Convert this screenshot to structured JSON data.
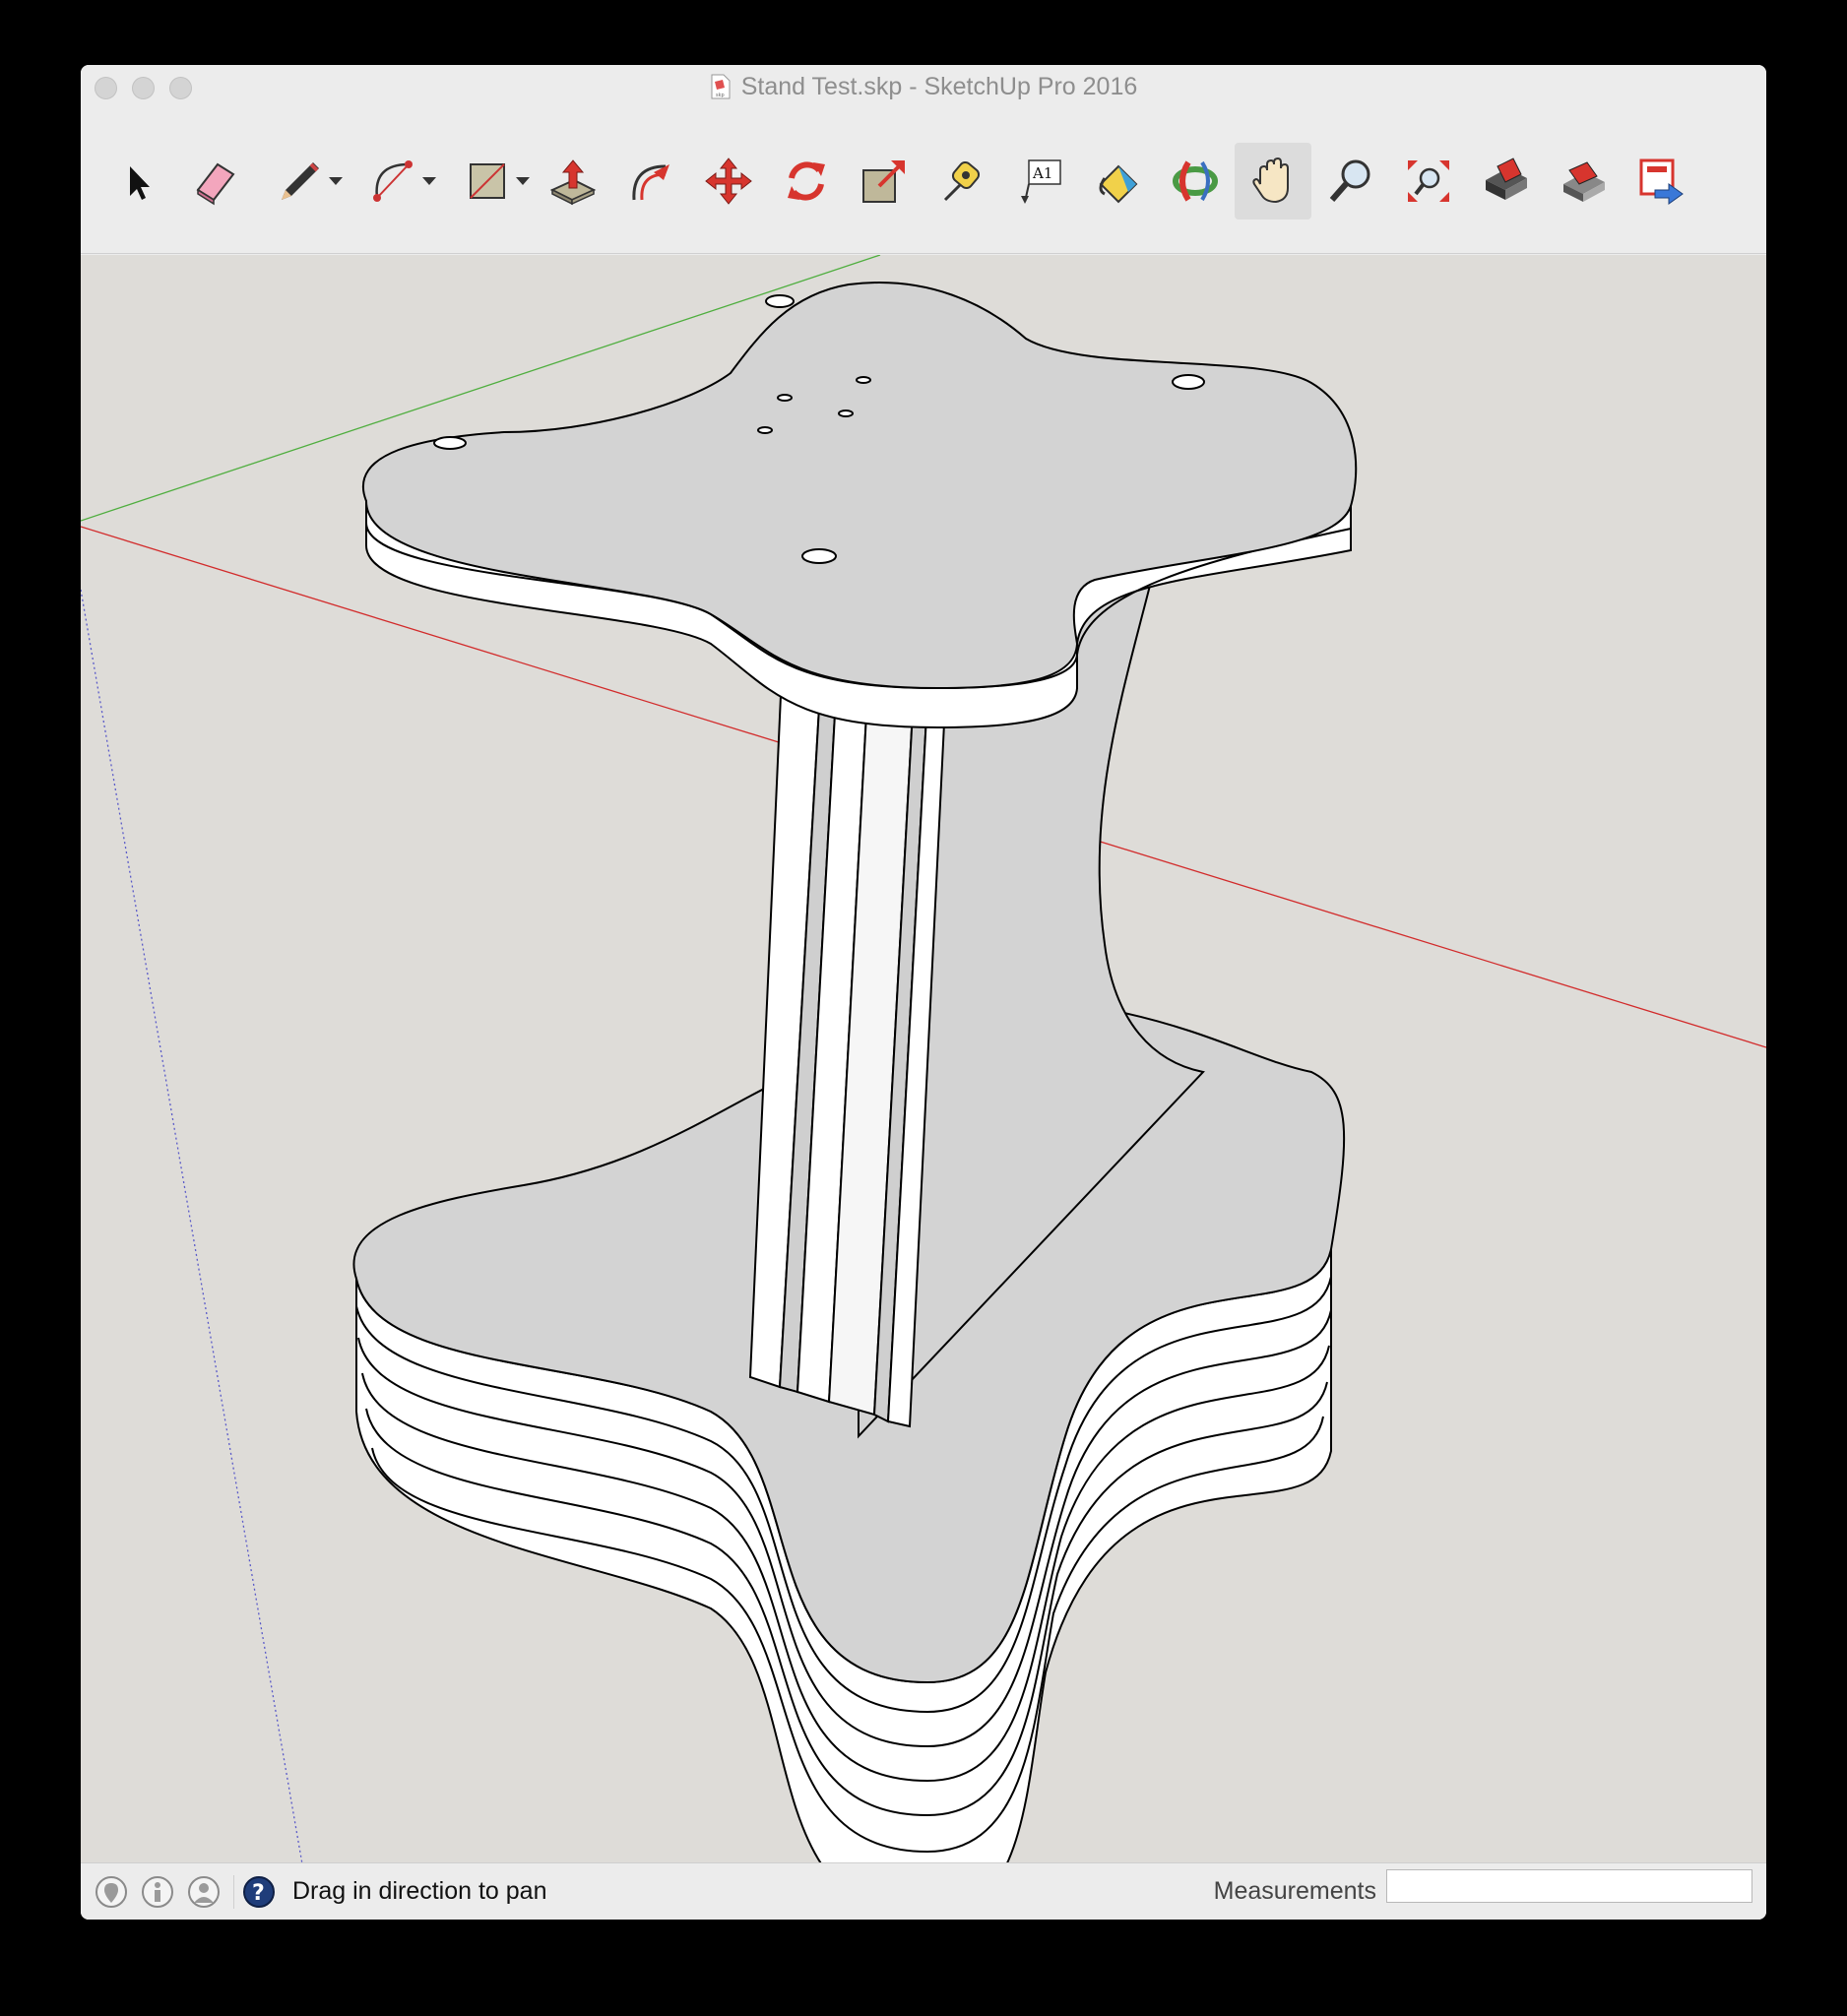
{
  "window": {
    "title": "Stand Test.skp - SketchUp Pro 2016"
  },
  "toolbar": {
    "tools": [
      {
        "name": "select",
        "icon": "arrow-cursor-icon"
      },
      {
        "name": "eraser",
        "icon": "eraser-icon"
      },
      {
        "name": "line",
        "icon": "pencil-icon",
        "has_dropdown": true
      },
      {
        "name": "arc",
        "icon": "arc-icon",
        "has_dropdown": true
      },
      {
        "name": "rectangle",
        "icon": "rectangle-icon",
        "has_dropdown": true
      },
      {
        "name": "push-pull",
        "icon": "push-pull-icon"
      },
      {
        "name": "offset",
        "icon": "offset-icon"
      },
      {
        "name": "move",
        "icon": "move-icon"
      },
      {
        "name": "rotate",
        "icon": "rotate-icon"
      },
      {
        "name": "scale",
        "icon": "scale-icon"
      },
      {
        "name": "tape-measure",
        "icon": "tape-measure-icon"
      },
      {
        "name": "text",
        "icon": "text-icon",
        "label": "A1"
      },
      {
        "name": "paint-bucket",
        "icon": "paint-bucket-icon"
      },
      {
        "name": "orbit",
        "icon": "orbit-icon"
      },
      {
        "name": "pan",
        "icon": "hand-icon",
        "active": true
      },
      {
        "name": "zoom",
        "icon": "magnifier-icon"
      },
      {
        "name": "zoom-extents",
        "icon": "zoom-extents-icon"
      },
      {
        "name": "warehouse",
        "icon": "warehouse-icon"
      },
      {
        "name": "extension-warehouse",
        "icon": "extension-warehouse-icon"
      },
      {
        "name": "send-to-layout",
        "icon": "layout-icon"
      }
    ]
  },
  "statusbar": {
    "icons": [
      "geo-location-icon",
      "credits-icon",
      "user-icon",
      "help-icon"
    ],
    "message": "Drag in direction to pan",
    "measurements_label": "Measurements",
    "measurements_value": ""
  },
  "colors": {
    "viewport_background": "#dedcd8",
    "model_face": "#d3d3d3",
    "model_side": "#ffffff",
    "edge": "#000000",
    "red_axis": "#d22b2b",
    "green_axis": "#4fae3f",
    "blue_axis": "#5a5ac8",
    "active_tool_bg": "#dcdcdc"
  }
}
